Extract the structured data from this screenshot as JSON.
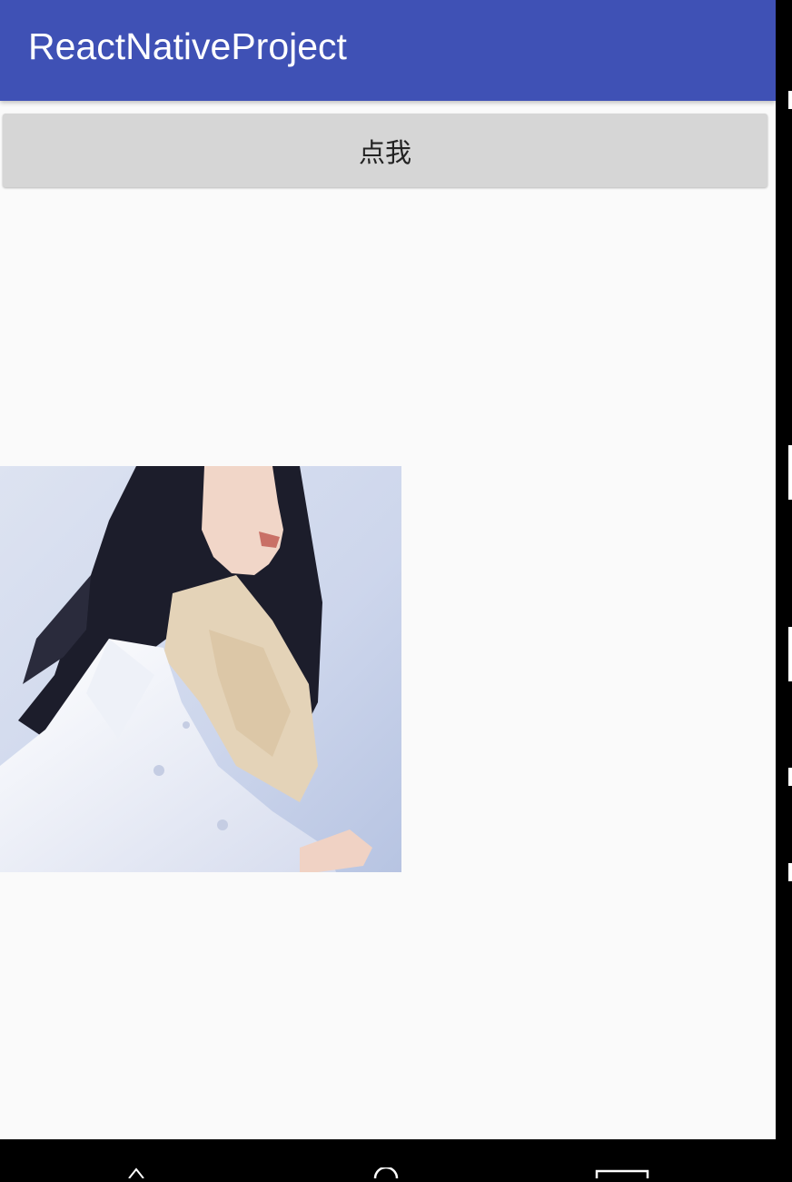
{
  "appbar": {
    "title": "ReactNativeProject",
    "color": "#3f51b5"
  },
  "button": {
    "label": "点我",
    "color": "#d6d6d6"
  },
  "photo": {
    "description_icon": "portrait-photo"
  },
  "navbar": {
    "items": [
      "back-icon",
      "home-icon",
      "recents-icon"
    ]
  }
}
